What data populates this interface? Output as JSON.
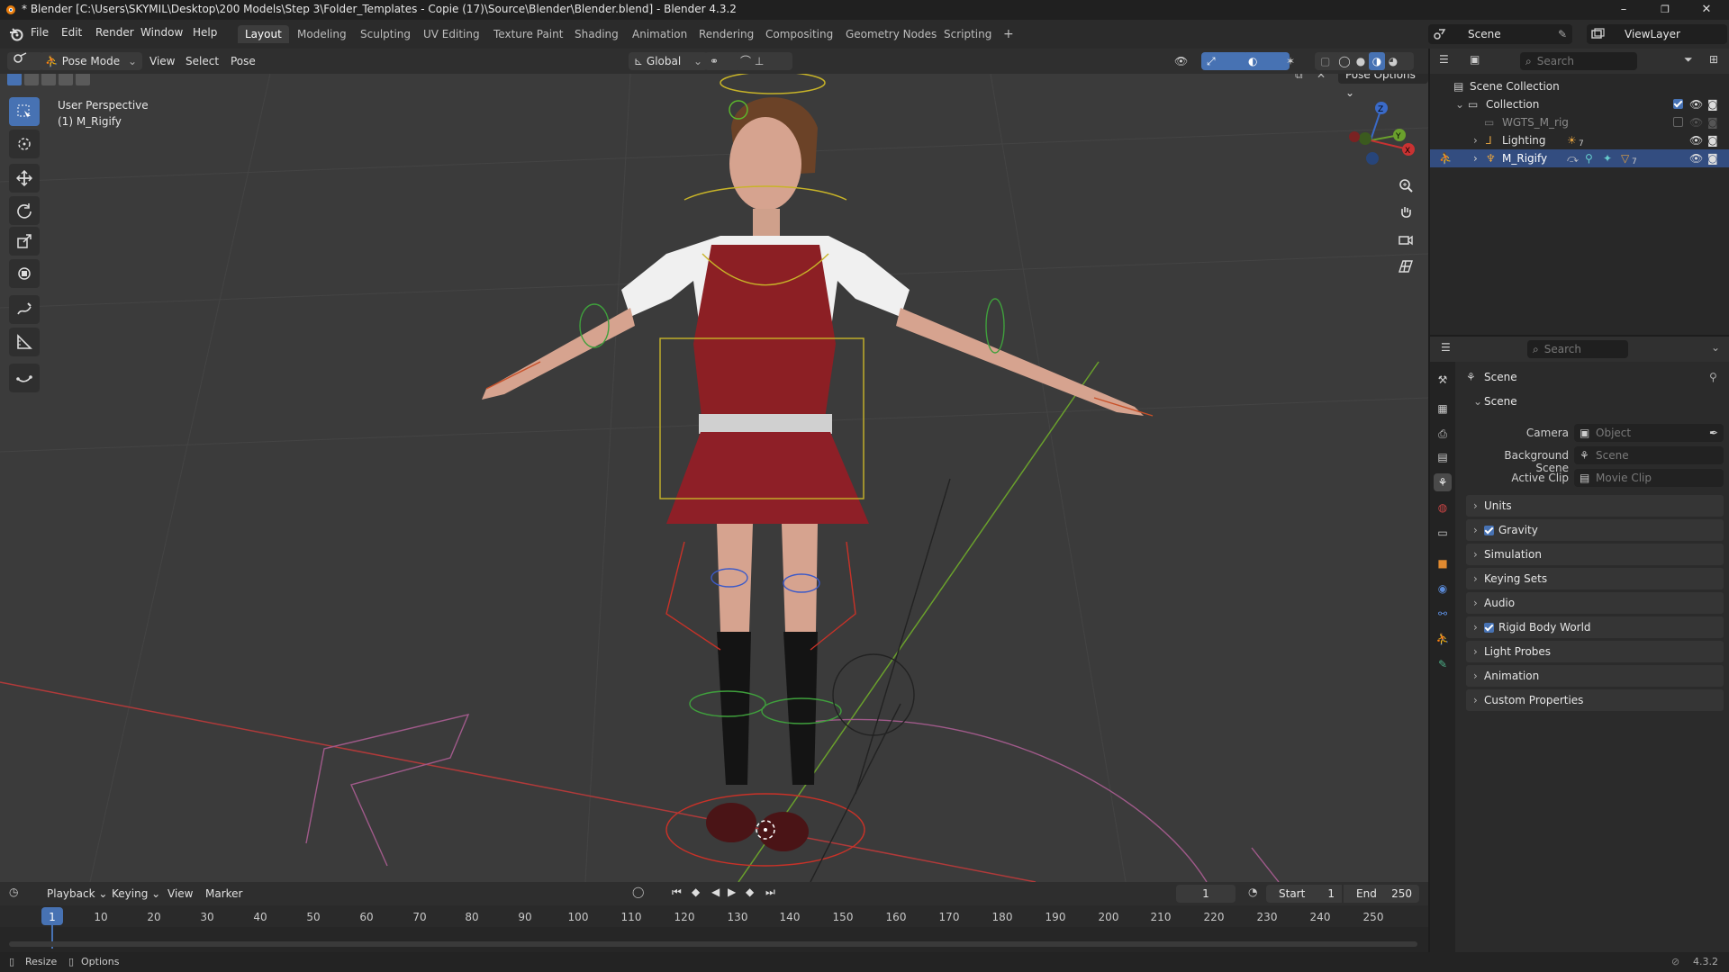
{
  "window": {
    "title": "* Blender [C:\\Users\\SKYMIL\\Desktop\\200 Models\\Step 3\\Folder_Templates - Copie (17)\\Source\\Blender\\Blender.blend] - Blender 4.3.2",
    "minimize": "–",
    "maximize": "❐",
    "close": "✕"
  },
  "menu": [
    "File",
    "Edit",
    "Render",
    "Window",
    "Help"
  ],
  "workspaces": [
    "Layout",
    "Modeling",
    "Sculpting",
    "UV Editing",
    "Texture Paint",
    "Shading",
    "Animation",
    "Rendering",
    "Compositing",
    "Geometry Nodes",
    "Scripting"
  ],
  "workspace_add": "+",
  "scene_selector": {
    "label": "Scene",
    "view_layer": "ViewLayer"
  },
  "viewport_header": {
    "mode": "Pose Mode",
    "menus": [
      "View",
      "Select",
      "Pose"
    ],
    "transform_orientation": "Global",
    "pose_options": "Pose Options"
  },
  "viewport": {
    "perspective": "User Perspective",
    "object": "(1) M_Rigify",
    "gizmo": {
      "x": "X",
      "y": "Y",
      "z": "Z"
    }
  },
  "outliner": {
    "search_placeholder": "Search",
    "root": "Scene Collection",
    "items": [
      {
        "label": "Collection"
      },
      {
        "label": "WGTS_M_rig"
      },
      {
        "label": "Lighting",
        "badge": "7"
      },
      {
        "label": "M_Rigify",
        "badge": "7"
      }
    ]
  },
  "properties": {
    "search_placeholder": "Search",
    "context": "Scene",
    "panel_scene": "Scene",
    "fields": [
      {
        "label": "Camera",
        "placeholder": "Object"
      },
      {
        "label": "Background Scene",
        "placeholder": "Scene"
      },
      {
        "label": "Active Clip",
        "placeholder": "Movie Clip"
      }
    ],
    "panels": [
      {
        "label": "Units",
        "checkbox": false
      },
      {
        "label": "Gravity",
        "checkbox": true
      },
      {
        "label": "Simulation",
        "checkbox": false
      },
      {
        "label": "Keying Sets",
        "checkbox": false
      },
      {
        "label": "Audio",
        "checkbox": false
      },
      {
        "label": "Rigid Body World",
        "checkbox": true
      },
      {
        "label": "Light Probes",
        "checkbox": false
      },
      {
        "label": "Animation",
        "checkbox": false
      },
      {
        "label": "Custom Properties",
        "checkbox": false
      }
    ]
  },
  "timeline": {
    "menus": [
      "Playback",
      "Keying",
      "View",
      "Marker"
    ],
    "current_frame": "1",
    "start_label": "Start",
    "start": "1",
    "end_label": "End",
    "end": "250",
    "ticks": [
      "1",
      "10",
      "20",
      "30",
      "40",
      "50",
      "60",
      "70",
      "80",
      "90",
      "100",
      "110",
      "120",
      "130",
      "140",
      "150",
      "160",
      "170",
      "180",
      "190",
      "200",
      "210",
      "220",
      "230",
      "240",
      "250"
    ]
  },
  "statusbar": {
    "left1": "Resize",
    "left2": "Options",
    "version": "4.3.2"
  }
}
